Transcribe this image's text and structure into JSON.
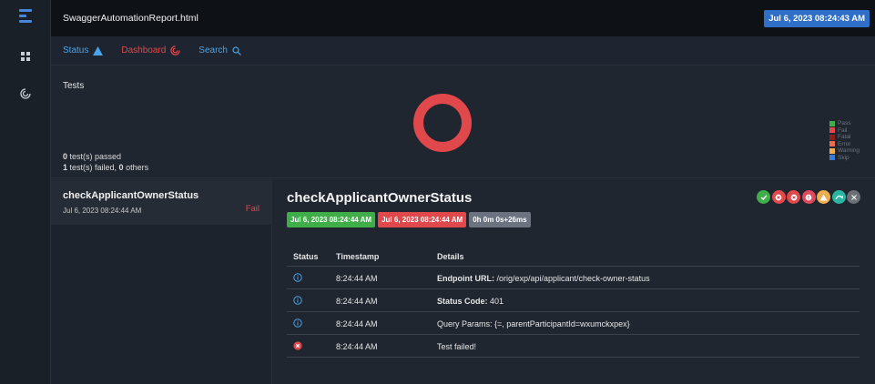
{
  "app": {
    "file_title": "SwaggerAutomationReport.html",
    "date_badge": "Jul 6, 2023 08:24:43 AM"
  },
  "nav": {
    "status_label": "Status",
    "dashboard_label": "Dashboard",
    "search_label": "Search"
  },
  "tests_panel": {
    "title": "Tests",
    "passed_count": "0",
    "passed_text": " test(s) passed",
    "failed_count": "1",
    "failed_text": " test(s) failed, ",
    "others_count": "0",
    "others_text": " others",
    "legend": [
      {
        "label": "Pass",
        "color": "#3fae49"
      },
      {
        "label": "Fail",
        "color": "#e0484c"
      },
      {
        "label": "Fatal",
        "color": "#8b1f1f"
      },
      {
        "label": "Error",
        "color": "#ee6a4c"
      },
      {
        "label": "Warning",
        "color": "#f0ad4e"
      },
      {
        "label": "Skip",
        "color": "#3a7bd5"
      }
    ],
    "donut_color": "#e0484c"
  },
  "test_list": {
    "items": [
      {
        "name": "checkApplicantOwnerStatus",
        "time": "Jul 6, 2023 08:24:44 AM",
        "status": "Fail"
      }
    ]
  },
  "detail": {
    "title": "checkApplicantOwnerStatus",
    "badges": {
      "start": "Jul 6, 2023 08:24:44 AM",
      "end": "Jul 6, 2023 08:24:44 AM",
      "duration": "0h 0m 0s+26ms"
    },
    "colors": {
      "start": "#3fae49",
      "end": "#e0484c",
      "duration": "#6b7280"
    },
    "filter_icons": [
      {
        "name": "pass-filter-icon",
        "color": "#3fae49"
      },
      {
        "name": "fail-filter-icon",
        "color": "#e0484c"
      },
      {
        "name": "fatal-filter-icon",
        "color": "#e0484c"
      },
      {
        "name": "error-filter-icon",
        "color": "#e0485c"
      },
      {
        "name": "warning-filter-icon",
        "color": "#f0ad4e"
      },
      {
        "name": "skip-filter-icon",
        "color": "#2bb5a0"
      },
      {
        "name": "clear-filter-icon",
        "color": "#6b6f76"
      }
    ],
    "table": {
      "headers": {
        "status": "Status",
        "timestamp": "Timestamp",
        "details": "Details"
      },
      "rows": [
        {
          "status_icon": "info-icon",
          "time": "8:24:44 AM",
          "detail_bold": "Endpoint URL:",
          "detail_text": " /orig/exp/api/applicant/check-owner-status"
        },
        {
          "status_icon": "info-icon",
          "time": "8:24:44 AM",
          "detail_bold": "Status Code:",
          "detail_text": " 401"
        },
        {
          "status_icon": "info-icon",
          "time": "8:24:44 AM",
          "detail_bold": "",
          "detail_text": "Query Params: {=, parentParticipantId=wxumckxpex}"
        },
        {
          "status_icon": "fail-icon",
          "time": "8:24:44 AM",
          "detail_bold": "",
          "detail_text": "Test failed!"
        }
      ]
    }
  }
}
